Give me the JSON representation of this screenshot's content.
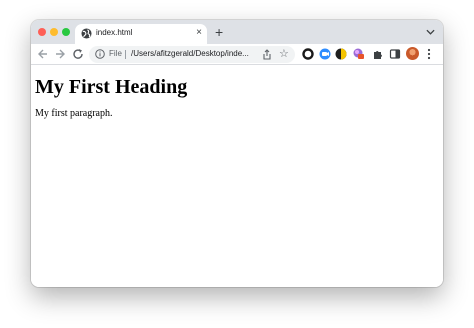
{
  "tab": {
    "title": "index.html",
    "close_glyph": "×"
  },
  "new_tab_glyph": "+",
  "address_bar": {
    "scheme_label": "File",
    "url": "/Users/afitzgerald/Desktop/inde..."
  },
  "page": {
    "heading": "My First Heading",
    "paragraph": "My first paragraph."
  },
  "icons": {
    "star": "☆"
  }
}
